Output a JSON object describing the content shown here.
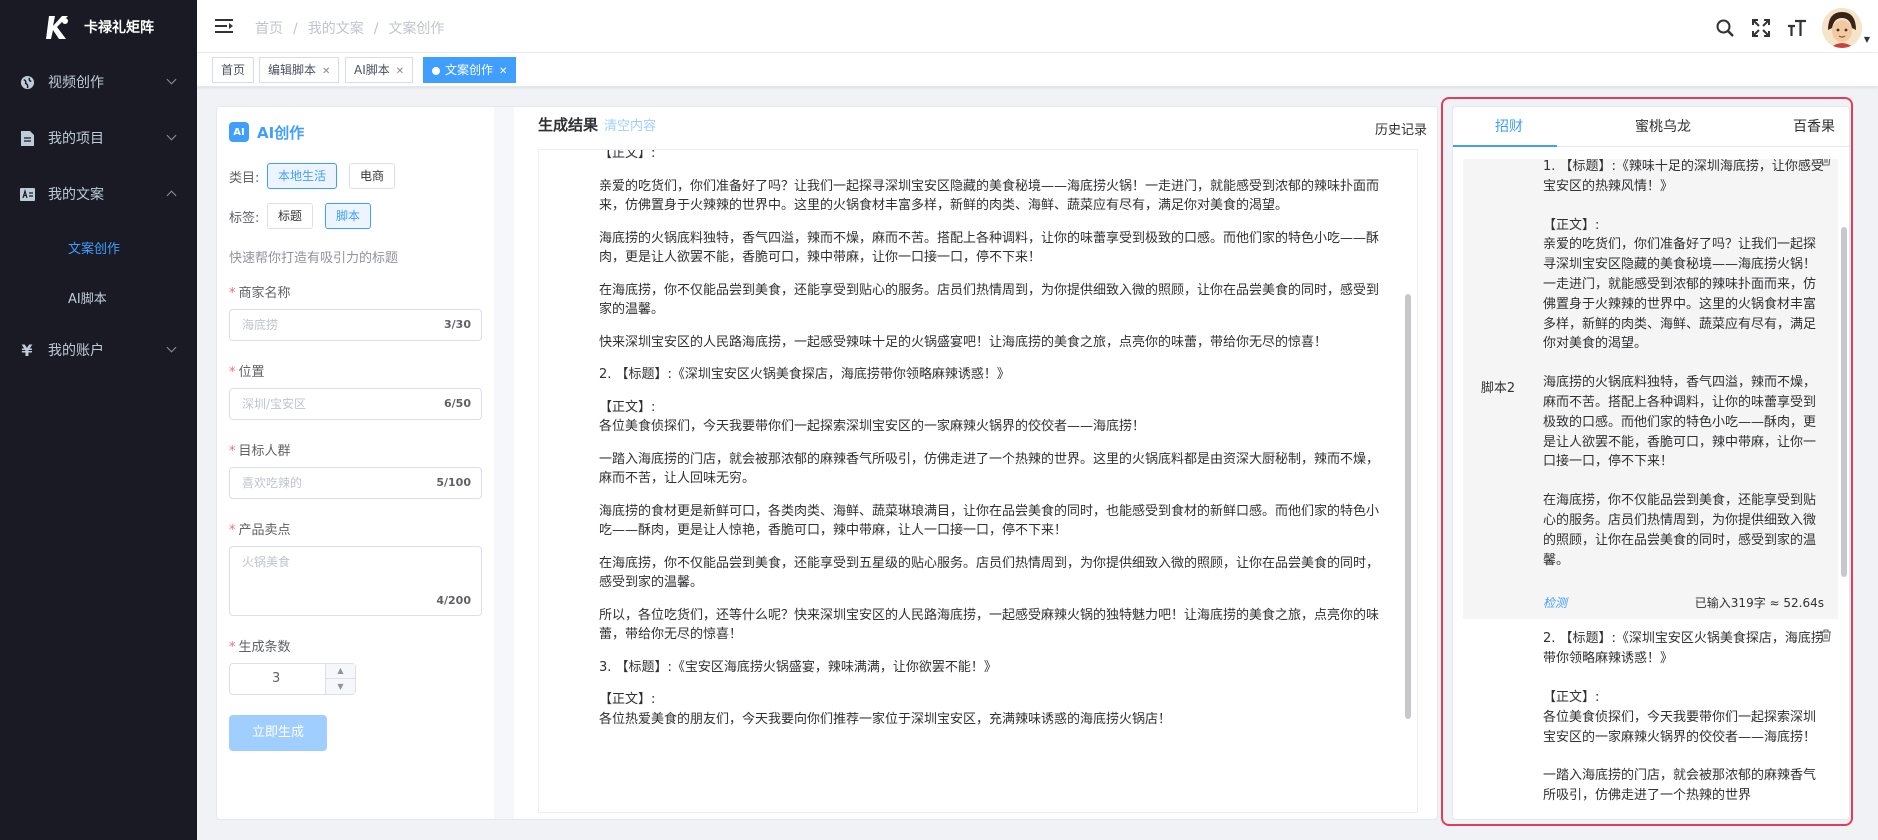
{
  "app": {
    "title": "卡禄礼矩阵"
  },
  "sidebar": {
    "items": [
      {
        "label": "视频创作",
        "icon": "globe-icon"
      },
      {
        "label": "我的项目",
        "icon": "document-icon"
      },
      {
        "label": "我的文案",
        "icon": "image-text-icon",
        "children": [
          {
            "label": "文案创作",
            "active": true
          },
          {
            "label": "AI脚本",
            "active": false
          }
        ]
      },
      {
        "label": "我的账户",
        "icon": "yen-icon"
      }
    ]
  },
  "breadcrumb": [
    "首页",
    "我的文案",
    "文案创作"
  ],
  "tags": [
    {
      "label": "首页",
      "closable": false
    },
    {
      "label": "编辑脚本",
      "closable": true
    },
    {
      "label": "AI脚本",
      "closable": true
    },
    {
      "label": "文案创作",
      "closable": true,
      "active": true
    }
  ],
  "form": {
    "title": "AI创作",
    "badge": "AI",
    "category_label": "类目:",
    "categories": [
      "本地生活",
      "电商"
    ],
    "tag_label": "标签:",
    "tags": [
      "标题",
      "脚本"
    ],
    "hint": "快速帮你打造有吸引力的标题",
    "fields": {
      "merchant": {
        "label": "商家名称",
        "placeholder": "海底捞",
        "count": "3/30"
      },
      "location": {
        "label": "位置",
        "placeholder": "深圳/宝安区",
        "count": "6/50"
      },
      "audience": {
        "label": "目标人群",
        "placeholder": "喜欢吃辣的",
        "count": "5/100"
      },
      "selling": {
        "label": "产品卖点",
        "placeholder": "火锅美食",
        "count": "4/200"
      },
      "quantity": {
        "label": "生成条数",
        "value": "3"
      }
    },
    "generate_button": "立即生成"
  },
  "result": {
    "title": "生成结果",
    "clear": "清空内容",
    "history": "历史记录",
    "paragraphs": [
      "【正文】:",
      "亲爱的吃货们，你们准备好了吗？让我们一起探寻深圳宝安区隐藏的美食秘境——海底捞火锅！一走进门，就能感受到浓郁的辣味扑面而来，仿佛置身于火辣辣的世界中。这里的火锅食材丰富多样，新鲜的肉类、海鲜、蔬菜应有尽有，满足你对美食的渴望。",
      "海底捞的火锅底料独特，香气四溢，辣而不燥，麻而不苦。搭配上各种调料，让你的味蕾享受到极致的口感。而他们家的特色小吃——酥肉，更是让人欲罢不能，香脆可口，辣中带麻，让你一口接一口，停不下来！",
      "在海底捞，你不仅能品尝到美食，还能享受到贴心的服务。店员们热情周到，为你提供细致入微的照顾，让你在品尝美食的同时，感受到家的温馨。",
      "快来深圳宝安区的人民路海底捞，一起感受辣味十足的火锅盛宴吧！让海底捞的美食之旅，点亮你的味蕾，带给你无尽的惊喜！",
      "2. 【标题】:《深圳宝安区火锅美食探店，海底捞带你领略麻辣诱惑！》",
      "【正文】:\n各位美食侦探们，今天我要带你们一起探索深圳宝安区的一家麻辣火锅界的佼佼者——海底捞！",
      "一踏入海底捞的门店，就会被那浓郁的麻辣香气所吸引，仿佛走进了一个热辣的世界。这里的火锅底料都是由资深大厨秘制，辣而不燥，麻而不苦，让人回味无穷。",
      "海底捞的食材更是新鲜可口，各类肉类、海鲜、蔬菜琳琅满目，让你在品尝美食的同时，也能感受到食材的新鲜口感。而他们家的特色小吃——酥肉，更是让人惊艳，香脆可口，辣中带麻，让人一口接一口，停不下来！",
      "在海底捞，你不仅能品尝到美食，还能享受到五星级的贴心服务。店员们热情周到，为你提供细致入微的照顾，让你在品尝美食的同时，感受到家的温馨。",
      "所以，各位吃货们，还等什么呢？快来深圳宝安区的人民路海底捞，一起感受麻辣火锅的独特魅力吧！让海底捞的美食之旅，点亮你的味蕾，带给你无尽的惊喜！",
      "3. 【标题】:《宝安区海底捞火锅盛宴，辣味满满，让你欲罢不能！》",
      "【正文】:\n各位热爱美食的朋友们，今天我要向你们推荐一家位于深圳宝安区，充满辣味诱惑的海底捞火锅店！"
    ]
  },
  "scripts_panel": {
    "tabs": [
      "招财",
      "蜜桃乌龙",
      "百香果"
    ],
    "active_tab": "招财",
    "items": [
      {
        "index_label": "脚本2",
        "paragraphs": [
          "1. 【标题】:《辣味十足的深圳海底捞，让你感受宝安区的热辣风情！》",
          "【正文】:\n亲爱的吃货们，你们准备好了吗？让我们一起探寻深圳宝安区隐藏的美食秘境——海底捞火锅！一走进门，就能感受到浓郁的辣味扑面而来，仿佛置身于火辣辣的世界中。这里的火锅食材丰富多样，新鲜的肉类、海鲜、蔬菜应有尽有，满足你对美食的渴望。",
          "海底捞的火锅底料独特，香气四溢，辣而不燥，麻而不苦。搭配上各种调料，让你的味蕾享受到极致的口感。而他们家的特色小吃——酥肉，更是让人欲罢不能，香脆可口，辣中带麻，让你一口接一口，停不下来！",
          "在海底捞，你不仅能品尝到美食，还能享受到贴心的服务。店员们热情周到，为你提供细致入微的照顾，让你在品尝美食的同时，感受到家的温馨。"
        ],
        "detect": "检测",
        "stat": "已输入319字 ≈ 52.64s"
      },
      {
        "index_label": "",
        "paragraphs": [
          "2. 【标题】:《深圳宝安区火锅美食探店，海底捞带你领略麻辣诱惑！》",
          "【正文】:\n各位美食侦探们，今天我要带你们一起探索深圳宝安区的一家麻辣火锅界的佼佼者——海底捞！",
          "一踏入海底捞的门店，就会被那浓郁的麻辣香气所吸引，仿佛走进了一个热辣的世界"
        ]
      }
    ]
  },
  "colors": {
    "accent": "#409eff",
    "sidebar_bg": "#191a23",
    "highlight_frame": "#e43d5a"
  }
}
